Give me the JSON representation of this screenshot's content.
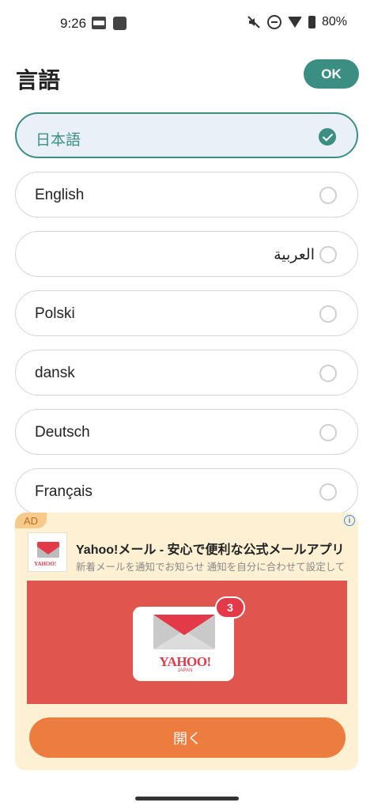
{
  "status_bar": {
    "time": "9:26",
    "battery": "80%",
    "icons": [
      "pdf-icon",
      "square-icon",
      "mute-icon",
      "dnd-icon",
      "wifi-icon",
      "battery-icon"
    ]
  },
  "header": {
    "title": "言語",
    "ok_label": "OK"
  },
  "colors": {
    "accent": "#3b8f82",
    "selected_bg": "#eaf0f8",
    "ad_bg": "#fdf0d3",
    "ad_button": "#ed7d3f",
    "ad_image_bg": "#e1554f"
  },
  "languages": [
    {
      "label": "日本語",
      "selected": true
    },
    {
      "label": "English",
      "selected": false
    },
    {
      "label": "العربية",
      "selected": false
    },
    {
      "label": "Polski",
      "selected": false
    },
    {
      "label": "dansk",
      "selected": false
    },
    {
      "label": "Deutsch",
      "selected": false
    },
    {
      "label": "Français",
      "selected": false
    }
  ],
  "ad": {
    "badge": "AD",
    "title": "Yahoo!メール - 安心で便利な公式メールアプリ",
    "description": "新着メールを通知でお知らせ 通知を自分に合わせて設定して",
    "image_logo": "YAHOO!",
    "image_logo_sub": "JAPAN",
    "notification_count": "3",
    "button_label": "開く"
  }
}
